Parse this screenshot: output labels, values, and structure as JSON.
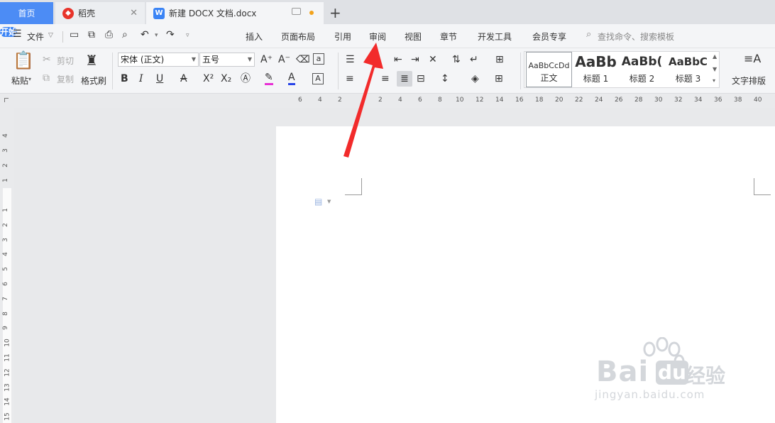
{
  "tabs": [
    {
      "label": "首页"
    },
    {
      "label": "稻壳",
      "icon": "daoke-logo-icon",
      "close": "✕"
    },
    {
      "label": "新建 DOCX 文档.docx",
      "icon": "writer-doc-icon"
    }
  ],
  "colors": {
    "accent": "#3b84f5",
    "arrow": "#f22b2b",
    "modified_dot": "#f2a21b"
  },
  "menu": {
    "file": "文件",
    "items": [
      "开始",
      "插入",
      "页面布局",
      "引用",
      "审阅",
      "视图",
      "章节",
      "开发工具",
      "会员专享"
    ],
    "search_placeholder": "查找命令、搜索模板"
  },
  "ribbon": {
    "paste": "粘贴",
    "cut": "剪切",
    "copy": "复制",
    "format_painter": "格式刷",
    "font_name": "宋体 (正文)",
    "font_size": "五号",
    "styles": [
      {
        "preview": "AaBbCcDd",
        "name": "正文"
      },
      {
        "preview": "AaBb",
        "name": "标题 1"
      },
      {
        "preview": "AaBb(",
        "name": "标题 2"
      },
      {
        "preview": "AaBbC",
        "name": "标题 3"
      }
    ],
    "text_layout": "文字排版"
  },
  "ruler": {
    "h_ticks": [
      "6",
      "4",
      "2",
      "2",
      "4",
      "6",
      "8",
      "10",
      "12",
      "14",
      "16",
      "18",
      "20",
      "22",
      "24",
      "26",
      "28",
      "30",
      "32",
      "34",
      "36",
      "38",
      "40"
    ],
    "v_ticks": [
      "4",
      "3",
      "2",
      "1",
      "1",
      "2",
      "3",
      "4",
      "5",
      "6",
      "7",
      "8",
      "9",
      "10",
      "11",
      "12",
      "13",
      "14",
      "15"
    ]
  },
  "watermark": {
    "brand": "Bai",
    "brand2": "du",
    "suffix": "经验",
    "url": "jingyan.baidu.com"
  }
}
